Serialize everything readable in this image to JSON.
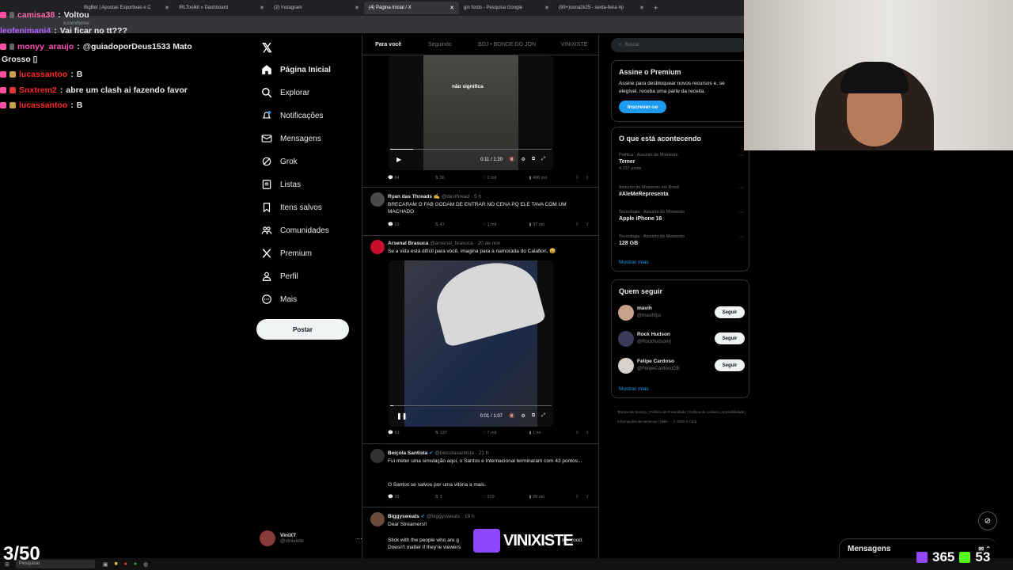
{
  "browser": {
    "tabs": [
      {
        "label": "BigBet | Apostas Esportivas e C"
      },
      {
        "label": "IRLToolkit » Dashboard"
      },
      {
        "label": "(2) Instagram"
      },
      {
        "label": "(4) Página Inicial / X",
        "active": true
      },
      {
        "label": "gin fords - Pesquisa Google"
      },
      {
        "label": "(99+)cena2k25 - sexta-feira #p"
      }
    ],
    "url": "x.com/home"
  },
  "chat": [
    {
      "user": "camisa38",
      "msg": "Voltou",
      "color": "#ff69b4"
    },
    {
      "user": "leofenimani4",
      "msg": "Vai ficar no tt???",
      "color": "#b05cff"
    },
    {
      "user": "monyy_araujo",
      "msg": "@guiadoporDeus1533 Mato",
      "color": "#ff4fb8"
    },
    {
      "msg": "Grosso ▯"
    },
    {
      "user": "lucassantoo",
      "msg": "B",
      "color": "#ff2a2a"
    },
    {
      "user": "Snxtrem2",
      "msg": "abre um clash ai fazendo favor",
      "color": "#ff2a2a"
    },
    {
      "user": "lucassantoo",
      "msg": "B",
      "color": "#ff2a2a"
    }
  ],
  "nav": {
    "items": [
      "Página Inicial",
      "Explorar",
      "Notificações",
      "Mensagens",
      "Grok",
      "Listas",
      "Itens salvos",
      "Comunidades",
      "Premium",
      "Perfil",
      "Mais"
    ],
    "post_label": "Postar",
    "account_name": "ViniXT",
    "account_handle": "@vinixiste"
  },
  "timeline": {
    "tabs": [
      "Para você",
      "Seguindo",
      "BDJ • BONDE DO JON",
      "VINIXISTE"
    ],
    "video1": {
      "caption": "não significa",
      "time": "0:11 / 1:20",
      "progress": 0.14
    },
    "tweet0_actions": [
      "84",
      "36",
      "2 mil",
      "496 mil"
    ],
    "tweets": [
      {
        "name": "Ryan das Threads ✍",
        "handle": "@dasthread · 5 h",
        "text": "BRECARAM O FAB GODAM DE ENTRAR NO CENA PQ ELE TAVA COM UM MACHADO",
        "actions": [
          "19",
          "47",
          "1 mil",
          "37 mil"
        ]
      },
      {
        "name": "Arsenal Brasuca",
        "handle": "@arsenal_brasuca · 20 de nov",
        "text": "Se a vida está difícil para você, imagina para a namorada do Calafiori. 😅",
        "video_time": "0:01 / 1:07",
        "progress": 0.02,
        "actions": [
          "53",
          "137",
          "7 mil",
          "1 mi"
        ]
      },
      {
        "name": "Beiçola Santista",
        "handle": "@beicolasantista · 21 h",
        "text": "Fui meter uma simulação aqui, o Santos e Internacional terminaram com 43 pontos...",
        "text2": "O Santos se salvou por uma vitória a mais.",
        "actions": [
          "29",
          "1",
          "319",
          "28 mil"
        ]
      },
      {
        "name": "Biggysweats",
        "handle": "@biggysweats · 19 h",
        "text": "Dear Streamers!!",
        "text2": "Stick with the people who are g",
        "text3": "Doesn't matter if they're viewers",
        "text_tail": "ing good."
      }
    ]
  },
  "right": {
    "search_placeholder": "Buscar",
    "premium": {
      "title": "Assine o Premium",
      "body": "Assine para desbloquear novos recursos e, se elegível, receba uma parte da receita.",
      "button": "Inscrever-se"
    },
    "trends_title": "O que está acontecendo",
    "trends": [
      {
        "cat": "Política · Assunto do Momento",
        "name": "Temer",
        "count": "4.237 posts"
      },
      {
        "cat": "Assunto do Momento em Brasil",
        "name": "#AleMeRepresenta",
        "count": ""
      },
      {
        "cat": "Tecnologia · Assunto do Momento",
        "name": "Apple iPhone 16",
        "count": ""
      },
      {
        "cat": "Tecnologia · Assunto do Momento",
        "name": "128 GB",
        "count": ""
      }
    ],
    "show_more": "Mostrar mais",
    "follow_title": "Quem seguir",
    "follow": [
      {
        "name": "mavih",
        "handle": "@mavihfps",
        "btn": "Seguir"
      },
      {
        "name": "Rock Hudson",
        "handle": "@Rockhudsonrj",
        "btn": "Seguir"
      },
      {
        "name": "Felipe Cardoso",
        "handle": "@FelipeCardosoDB",
        "btn": "Seguir"
      }
    ],
    "footer": [
      "Termos de Serviço",
      "Política de Privacidade",
      "Política de cookies",
      "Acessibilidade",
      "Informações de anúncios",
      "Mais ···",
      "© 2025 X Corp."
    ]
  },
  "overlay": {
    "counter": "3/50",
    "brand": "VINIXISTE",
    "viewers": "365",
    "kick": "53",
    "messages": "Mensagens",
    "search": "Pesquisar"
  }
}
